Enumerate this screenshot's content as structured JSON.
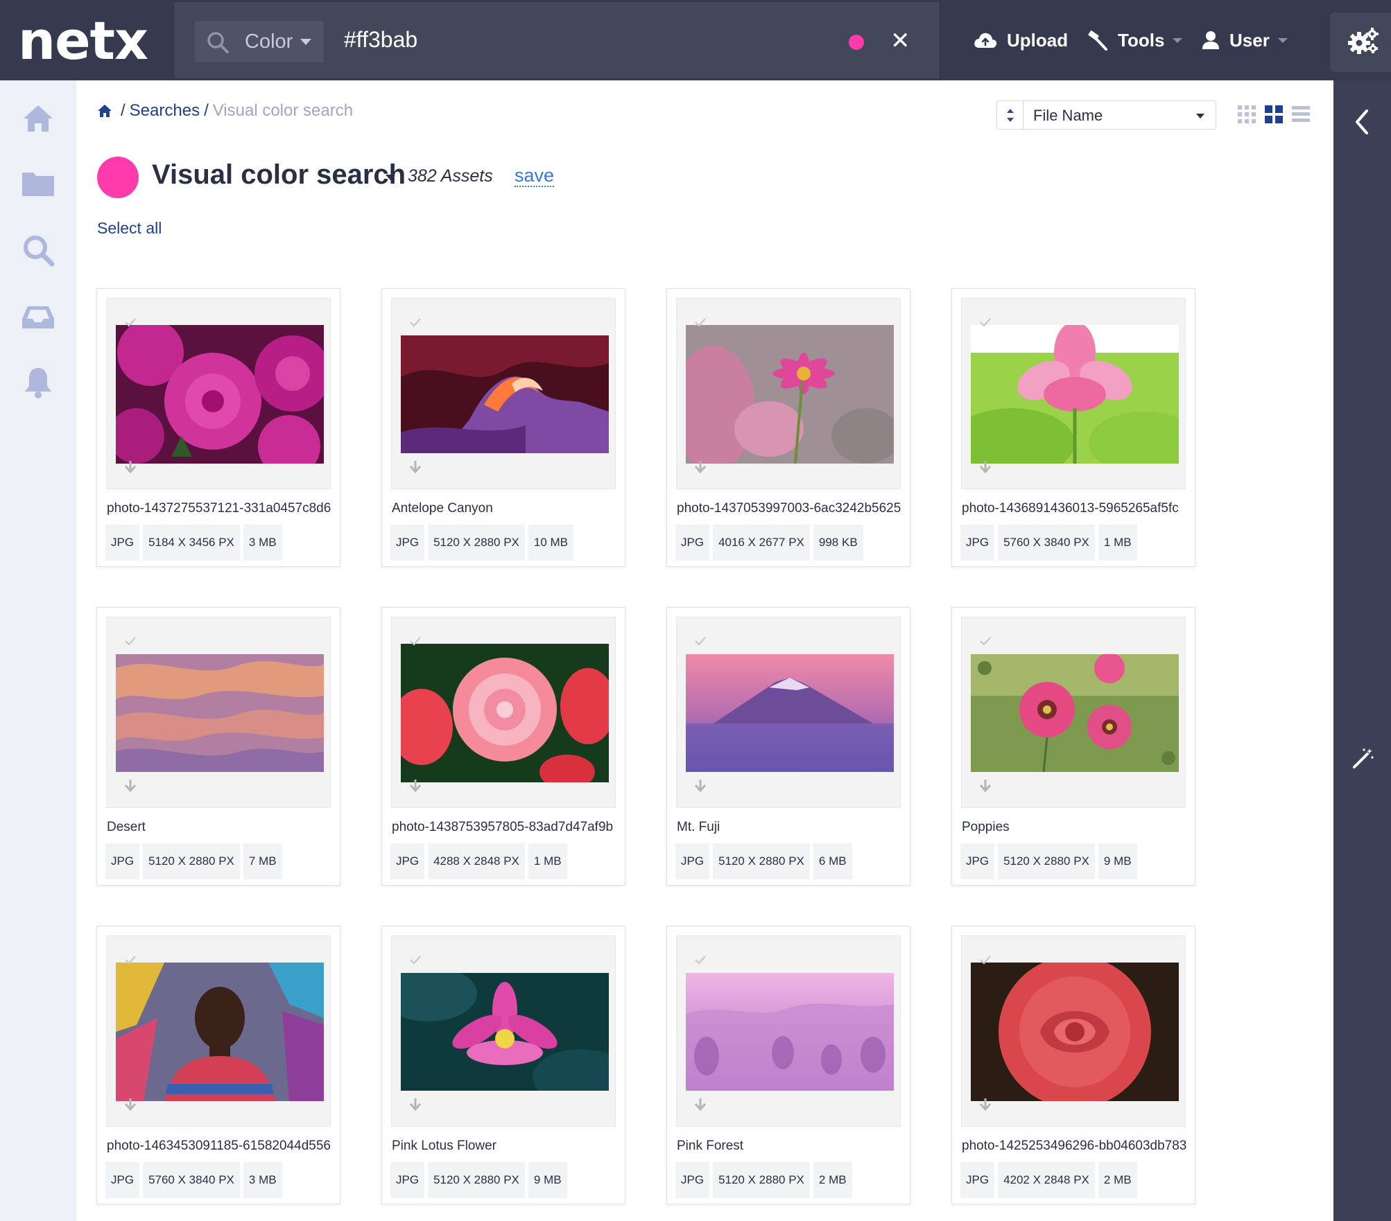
{
  "app": {
    "logo": "netx"
  },
  "search": {
    "type_label": "Color",
    "query": "#ff3bab",
    "swatch_color": "#ff3bab"
  },
  "nav": {
    "upload": "Upload",
    "tools": "Tools",
    "user": "User"
  },
  "breadcrumb": {
    "searches": "Searches",
    "separator": "/",
    "current": "Visual color search"
  },
  "sort": {
    "label": "File Name"
  },
  "header": {
    "title": "Visual color search",
    "asset_count": "382 Assets",
    "save": "save",
    "select_all": "Select all"
  },
  "colors": {
    "topbar": "#353a4f",
    "accent_pink": "#ff3bab",
    "link_blue": "#1f3f8f",
    "rightbar": "#3b4057"
  },
  "assets": [
    {
      "name": "photo-1437275537121-331a0457c8d6",
      "format": "JPG",
      "dimensions": "5184 X 3456 PX",
      "size": "3 MB",
      "thumb": "dahlias"
    },
    {
      "name": "Antelope Canyon",
      "format": "JPG",
      "dimensions": "5120 X 2880 PX",
      "size": "10 MB",
      "thumb": "canyon"
    },
    {
      "name": "photo-1437053997003-6ac3242b5625",
      "format": "JPG",
      "dimensions": "4016 X 2677 PX",
      "size": "998 KB",
      "thumb": "pink-daisy"
    },
    {
      "name": "photo-1436891436013-5965265af5fc",
      "format": "JPG",
      "dimensions": "5760 X 3840 PX",
      "size": "1 MB",
      "thumb": "lotus-green"
    },
    {
      "name": "Desert",
      "format": "JPG",
      "dimensions": "5120 X 2880 PX",
      "size": "7 MB",
      "thumb": "desert"
    },
    {
      "name": "photo-1438753957805-83ad7d47af9b",
      "format": "JPG",
      "dimensions": "4288 X 2848 PX",
      "size": "1 MB",
      "thumb": "begonia"
    },
    {
      "name": "Mt. Fuji",
      "format": "JPG",
      "dimensions": "5120 X 2880 PX",
      "size": "6 MB",
      "thumb": "fuji"
    },
    {
      "name": "Poppies",
      "format": "JPG",
      "dimensions": "5120 X 2880 PX",
      "size": "9 MB",
      "thumb": "poppies"
    },
    {
      "name": "photo-1463453091185-61582044d556",
      "format": "JPG",
      "dimensions": "5760 X 3840 PX",
      "size": "3 MB",
      "thumb": "portrait"
    },
    {
      "name": "Pink Lotus Flower",
      "format": "JPG",
      "dimensions": "5120 X 2880 PX",
      "size": "9 MB",
      "thumb": "lotus-dark"
    },
    {
      "name": "Pink Forest",
      "format": "JPG",
      "dimensions": "5120 X 2880 PX",
      "size": "2 MB",
      "thumb": "pink-forest"
    },
    {
      "name": "photo-1425253496296-bb04603db783",
      "format": "JPG",
      "dimensions": "4202 X 2848 PX",
      "size": "2 MB",
      "thumb": "rose"
    }
  ]
}
